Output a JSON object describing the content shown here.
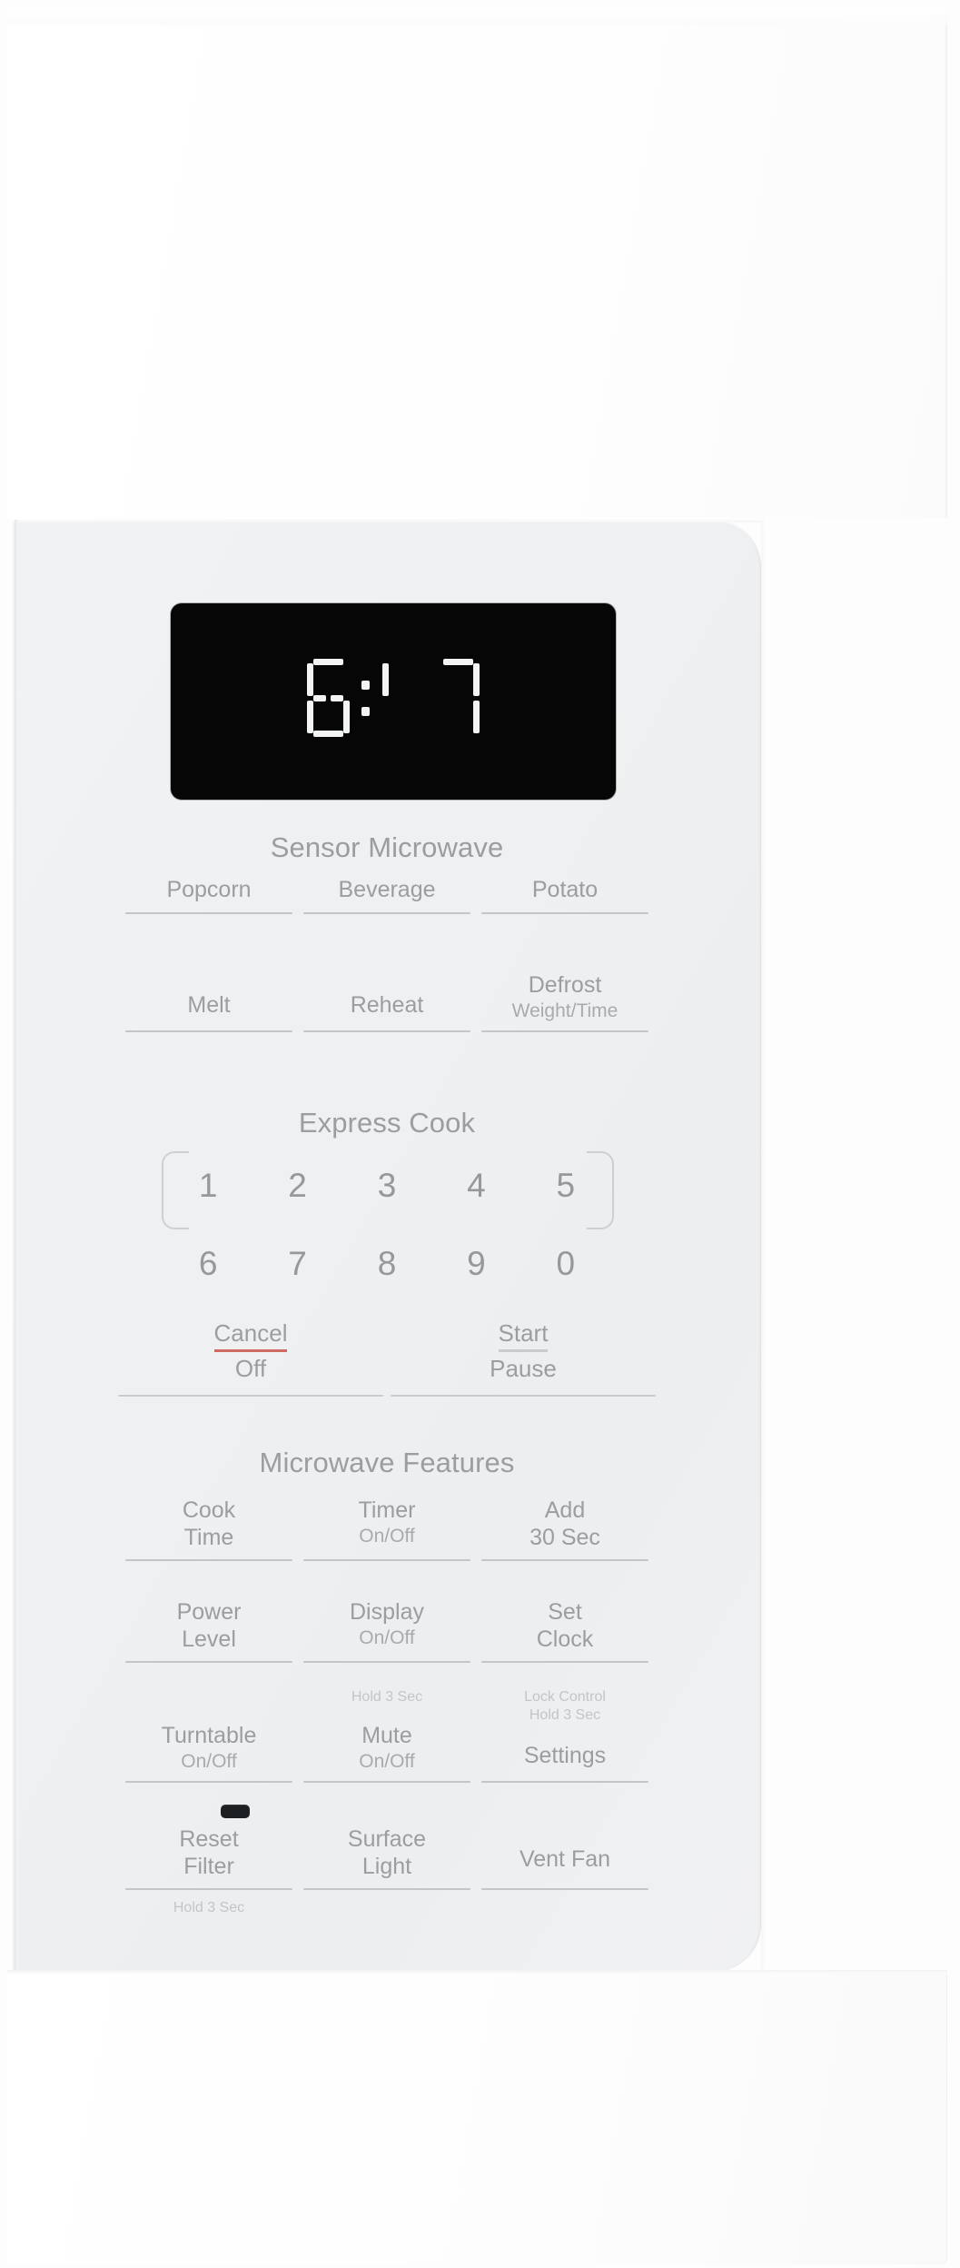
{
  "appliance": {
    "type": "over-the-range-microwave",
    "finish_color": "#ffffff",
    "panel_color": "#eef0f2",
    "label_color": "#9b9ea1",
    "accent_color": "#cf6b63"
  },
  "display": {
    "value": "6:17",
    "segments": [
      "6",
      ":",
      "1",
      "7"
    ],
    "background": "#060607",
    "segment_color": "#f2f3f3"
  },
  "sensor_microwave": {
    "title": "Sensor Microwave",
    "row1": [
      {
        "label": "Popcorn",
        "sub": "",
        "tiny": ""
      },
      {
        "label": "Beverage",
        "sub": "",
        "tiny": ""
      },
      {
        "label": "Potato",
        "sub": "",
        "tiny": ""
      }
    ],
    "row2": [
      {
        "label": "Melt",
        "sub": "",
        "tiny": ""
      },
      {
        "label": "Reheat",
        "sub": "",
        "tiny": ""
      },
      {
        "label": "Defrost",
        "sub": "Weight/Time",
        "tiny": ""
      }
    ]
  },
  "express_cook": {
    "title": "Express Cook",
    "row1": [
      "1",
      "2",
      "3",
      "4",
      "5"
    ],
    "row2": [
      "6",
      "7",
      "8",
      "9",
      "0"
    ],
    "cancel": {
      "top": "Cancel",
      "bottom": "Off",
      "accent": true
    },
    "start": {
      "top": "Start",
      "bottom": "Pause",
      "accent": false
    }
  },
  "microwave_features": {
    "title": "Microwave Features",
    "row1": [
      {
        "label": "Cook",
        "sub": "Time",
        "tiny_above": "",
        "tiny_below": ""
      },
      {
        "label": "Timer",
        "sub": "On/Off",
        "tiny_above": "",
        "tiny_below": ""
      },
      {
        "label": "Add",
        "sub": "30 Sec",
        "tiny_above": "",
        "tiny_below": ""
      }
    ],
    "row2": [
      {
        "label": "Power",
        "sub": "Level",
        "tiny_above": "",
        "tiny_below": ""
      },
      {
        "label": "Display",
        "sub": "On/Off",
        "tiny_above": "",
        "tiny_below": "Hold 3 Sec"
      },
      {
        "label": "Set",
        "sub": "Clock",
        "tiny_above": "",
        "tiny_below": "Lock Control\nHold 3 Sec"
      }
    ],
    "row3": [
      {
        "label": "Turntable",
        "sub": "On/Off",
        "tiny_above": "",
        "tiny_below": ""
      },
      {
        "label": "Mute",
        "sub": "On/Off",
        "tiny_above": "",
        "tiny_below": ""
      },
      {
        "label": "Settings",
        "sub": "",
        "tiny_above": "",
        "tiny_below": ""
      }
    ],
    "row4": [
      {
        "label": "Reset",
        "sub": "Filter",
        "tiny_above": "",
        "tiny_below": "Hold 3 Sec",
        "indicator": true
      },
      {
        "label": "Surface",
        "sub": "Light",
        "tiny_above": "",
        "tiny_below": ""
      },
      {
        "label": "Vent Fan",
        "sub": "",
        "tiny_above": "",
        "tiny_below": ""
      }
    ]
  }
}
